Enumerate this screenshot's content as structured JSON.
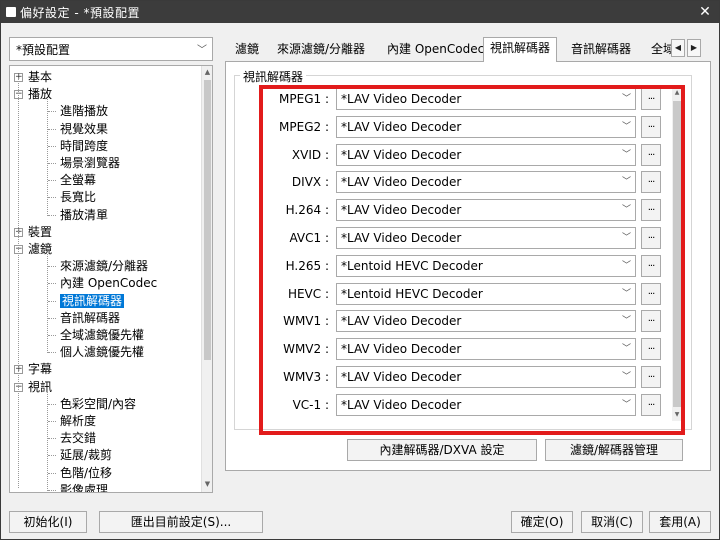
{
  "window": {
    "title": "偏好設定 - *預設配置"
  },
  "profile": {
    "selected": "*預設配置"
  },
  "tree": {
    "items": [
      {
        "label": "基本",
        "expander": "+"
      },
      {
        "label": "播放",
        "expander": "−"
      },
      {
        "label": "進階播放"
      },
      {
        "label": "視覺效果"
      },
      {
        "label": "時間跨度"
      },
      {
        "label": "場景瀏覽器"
      },
      {
        "label": "全螢幕"
      },
      {
        "label": "長寬比"
      },
      {
        "label": "播放清單"
      },
      {
        "label": "裝置",
        "expander": "+"
      },
      {
        "label": "濾鏡",
        "expander": "−"
      },
      {
        "label": "來源濾鏡/分離器"
      },
      {
        "label": "內建 OpenCodec"
      },
      {
        "label": "視訊解碼器",
        "selected": true
      },
      {
        "label": "音訊解碼器"
      },
      {
        "label": "全域濾鏡優先權"
      },
      {
        "label": "個人濾鏡優先權"
      },
      {
        "label": "字幕",
        "expander": "+"
      },
      {
        "label": "視訊",
        "expander": "−"
      },
      {
        "label": "色彩空間/內容"
      },
      {
        "label": "解析度"
      },
      {
        "label": "去交錯"
      },
      {
        "label": "延展/裁剪"
      },
      {
        "label": "色階/位移"
      },
      {
        "label": "影像處理"
      }
    ]
  },
  "tabs": [
    {
      "label": "濾鏡"
    },
    {
      "label": "來源濾鏡/分離器"
    },
    {
      "label": "內建 OpenCodec"
    },
    {
      "label": "視訊解碼器",
      "active": true
    },
    {
      "label": "音訊解碼器"
    },
    {
      "label": "全域"
    }
  ],
  "group": {
    "title": "視訊解碼器"
  },
  "decoders": [
    {
      "label": "MPEG1 :",
      "value": "*LAV Video Decoder"
    },
    {
      "label": "MPEG2 :",
      "value": "*LAV Video Decoder"
    },
    {
      "label": "XVID :",
      "value": "*LAV Video Decoder"
    },
    {
      "label": "DIVX :",
      "value": "*LAV Video Decoder"
    },
    {
      "label": "H.264 :",
      "value": "*LAV Video Decoder"
    },
    {
      "label": "AVC1 :",
      "value": "*LAV Video Decoder"
    },
    {
      "label": "H.265 :",
      "value": "*Lentoid HEVC Decoder"
    },
    {
      "label": "HEVC :",
      "value": "*Lentoid HEVC Decoder"
    },
    {
      "label": "WMV1 :",
      "value": "*LAV Video Decoder"
    },
    {
      "label": "WMV2 :",
      "value": "*LAV Video Decoder"
    },
    {
      "label": "WMV3 :",
      "value": "*LAV Video Decoder"
    },
    {
      "label": "VC-1 :",
      "value": "*LAV Video Decoder"
    }
  ],
  "dots_label": "...",
  "panel_buttons": {
    "builtin_dxva": "內建解碼器/DXVA 設定",
    "filter_manager": "濾鏡/解碼器管理"
  },
  "bottom_buttons": {
    "initialize": "初始化(I)",
    "export": "匯出目前設定(S)...",
    "ok": "確定(O)",
    "cancel": "取消(C)",
    "apply": "套用(A)"
  },
  "highlight_color": "#e21b1b",
  "selection_color": "#0078d7"
}
